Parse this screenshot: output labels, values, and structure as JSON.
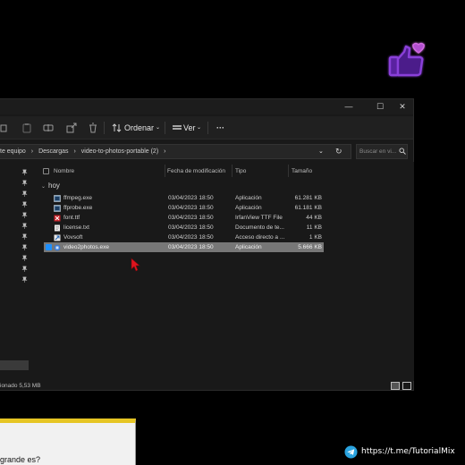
{
  "toolbar": {
    "sort_label": "Ordenar",
    "view_label": "Ver",
    "more_label": "···"
  },
  "window_controls": {
    "minimize": "—",
    "maximize": "☐",
    "close": "✕"
  },
  "address_bar": {
    "crumbs": [
      "te equipo",
      "Descargas",
      "video-to-photos-portable (2)"
    ],
    "separator": "›"
  },
  "search": {
    "placeholder": "Buscar en vi..."
  },
  "columns": {
    "name": "Nombre",
    "modified": "Fecha de modificación",
    "type": "Tipo",
    "size": "Tamaño"
  },
  "group": {
    "label": "hoy"
  },
  "files": [
    {
      "name": "ffmpeg.exe",
      "modified": "03/04/2023 18:50",
      "type": "Aplicación",
      "size": "61.281 KB",
      "icon": "exe-icon",
      "selected": false
    },
    {
      "name": "ffprobe.exe",
      "modified": "03/04/2023 18:50",
      "type": "Aplicación",
      "size": "61.181 KB",
      "icon": "exe-icon",
      "selected": false
    },
    {
      "name": "font.ttf",
      "modified": "03/04/2023 18:50",
      "type": "IrfanView TTF File",
      "size": "44 KB",
      "icon": "font-file-icon",
      "selected": false
    },
    {
      "name": "license.txt",
      "modified": "03/04/2023 18:50",
      "type": "Documento de te...",
      "size": "11 KB",
      "icon": "text-file-icon",
      "selected": false
    },
    {
      "name": "Vovsoft",
      "modified": "03/04/2023 18:50",
      "type": "Acceso directo a ...",
      "size": "1 KB",
      "icon": "shortcut-icon",
      "selected": false
    },
    {
      "name": "video2photos.exe",
      "modified": "03/04/2023 18:50",
      "type": "Aplicación",
      "size": "5.666 KB",
      "icon": "app-icon",
      "selected": true
    }
  ],
  "status": {
    "text": "ionado  5,53 MB"
  },
  "dialog": {
    "text": "grande es?"
  },
  "telegram": {
    "link": "https://t.me/TutorialMix"
  },
  "colors": {
    "window_bg": "#191919",
    "selected_row": "#777777",
    "accent_yellow": "#e6c524",
    "cursor_red": "#e0141e",
    "like_icon": "#8a3fd9"
  }
}
